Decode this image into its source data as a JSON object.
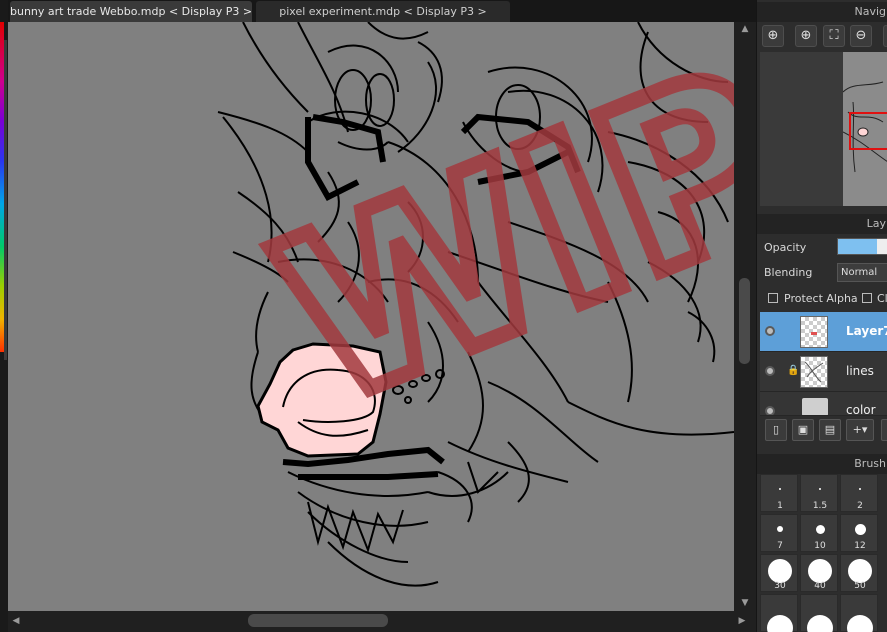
{
  "tabs": [
    {
      "label": "bunny art trade Webbo.mdp < Display P3 >"
    },
    {
      "label": "pixel experiment.mdp < Display P3 >"
    }
  ],
  "canvas": {
    "watermark_text": "WIP",
    "background_color": "#808080",
    "nose_color": "#ffd6d6",
    "watermark_color": "#a23a3e"
  },
  "navigator": {
    "title": "Navig"
  },
  "layers_panel": {
    "title": "Lay",
    "opacity_label": "Opacity",
    "opacity_value": 0.8,
    "blending_label": "Blending",
    "blending_value": "Normal",
    "protect_alpha_label": "Protect Alpha",
    "clip_label": "Cl",
    "layers": [
      {
        "name": "Layer7",
        "selected": true,
        "locked": false,
        "type": "layer"
      },
      {
        "name": "lines",
        "selected": false,
        "locked": true,
        "type": "layer"
      },
      {
        "name": "color",
        "selected": false,
        "locked": false,
        "type": "folder"
      }
    ]
  },
  "brush_panel": {
    "title": "Brush",
    "sizes": [
      {
        "label": "1"
      },
      {
        "label": "1.5"
      },
      {
        "label": "2"
      },
      {
        "label": "7"
      },
      {
        "label": "10"
      },
      {
        "label": "12"
      },
      {
        "label": "30"
      },
      {
        "label": "40"
      },
      {
        "label": "50"
      }
    ]
  },
  "colors": {
    "accent": "#5d9fd8",
    "selection_rect": "#e01010"
  }
}
